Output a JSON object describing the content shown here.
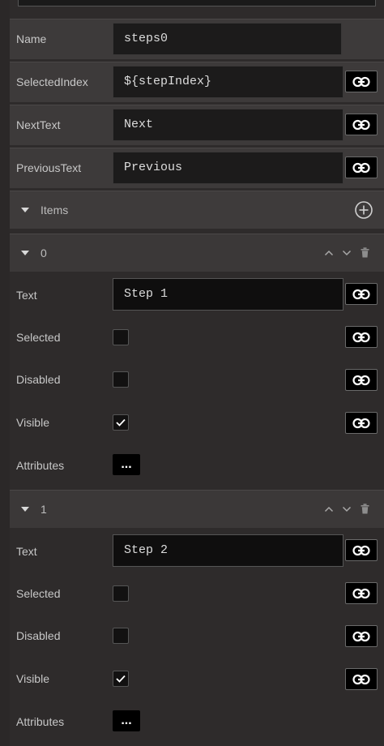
{
  "properties": {
    "name": {
      "label": "Name",
      "value": "steps0"
    },
    "selected_index": {
      "label": "SelectedIndex",
      "value": "${stepIndex}"
    },
    "next_text": {
      "label": "NextText",
      "value": "Next"
    },
    "previous_text": {
      "label": "PreviousText",
      "value": "Previous"
    }
  },
  "items_section": {
    "label": "Items"
  },
  "items": [
    {
      "index_label": "0",
      "text_label": "Text",
      "text_value": "Step 1",
      "selected_label": "Selected",
      "selected_checked": false,
      "disabled_label": "Disabled",
      "disabled_checked": false,
      "visible_label": "Visible",
      "visible_checked": true,
      "attributes_label": "Attributes",
      "attributes_button": "..."
    },
    {
      "index_label": "1",
      "text_label": "Text",
      "text_value": "Step 2",
      "selected_label": "Selected",
      "selected_checked": false,
      "disabled_label": "Disabled",
      "disabled_checked": false,
      "visible_label": "Visible",
      "visible_checked": true,
      "attributes_label": "Attributes",
      "attributes_button": "..."
    }
  ],
  "icons": {
    "link": "link-icon",
    "add": "add-circle-icon",
    "collapse": "triangle-down-icon",
    "move_up": "chevron-up-icon",
    "move_down": "chevron-down-icon",
    "delete": "trash-icon",
    "check": "checkmark-icon"
  },
  "colors": {
    "panel_bg": "#2e2b2b",
    "property_row_bg": "#3d3a3a",
    "field_bg": "#1c1b1b",
    "link_button_bg": "#000000"
  }
}
